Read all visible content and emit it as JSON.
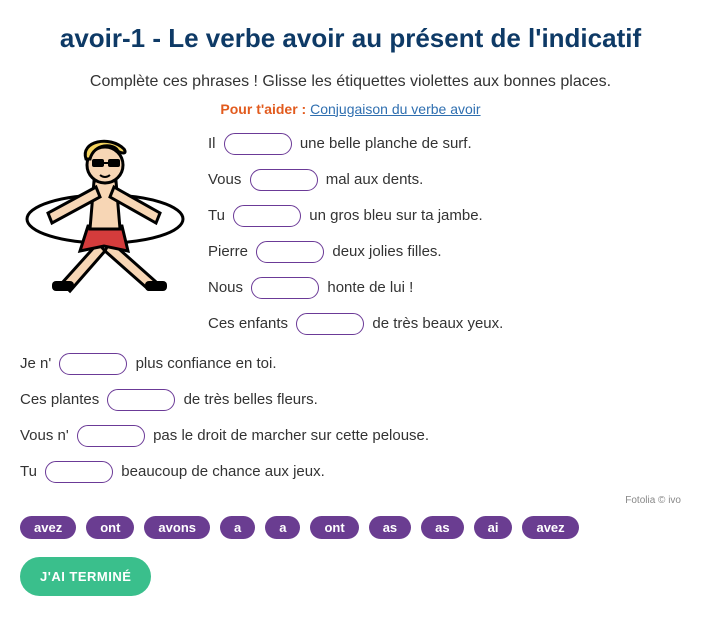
{
  "title": "avoir-1 - Le verbe avoir au présent de l'indicatif",
  "instruction": "Complète ces phrases ! Glisse les étiquettes violettes aux bonnes places.",
  "help": {
    "label": "Pour t'aider :",
    "link_text": "Conjugaison du verbe avoir"
  },
  "sentences_right": [
    {
      "before": "Il",
      "after": "une belle planche de surf."
    },
    {
      "before": "Vous",
      "after": "mal aux dents."
    },
    {
      "before": "Tu",
      "after": "un gros bleu sur ta jambe."
    },
    {
      "before": "Pierre",
      "after": "deux jolies filles."
    },
    {
      "before": "Nous",
      "after": "honte de lui !"
    },
    {
      "before": "Ces enfants",
      "after": "de très beaux yeux."
    }
  ],
  "sentences_full": [
    {
      "before": "Je n'",
      "after": "plus confiance en toi."
    },
    {
      "before": "Ces plantes",
      "after": "de très belles fleurs."
    },
    {
      "before": "Vous n'",
      "after": "pas le droit de marcher sur cette pelouse."
    },
    {
      "before": "Tu",
      "after": "beaucoup de chance aux jeux."
    }
  ],
  "credit": "Fotolia © ivo",
  "chips": [
    "avez",
    "ont",
    "avons",
    "a",
    "a",
    "ont",
    "as",
    "as",
    "ai",
    "avez"
  ],
  "done_button": "J'AI TERMINÉ"
}
